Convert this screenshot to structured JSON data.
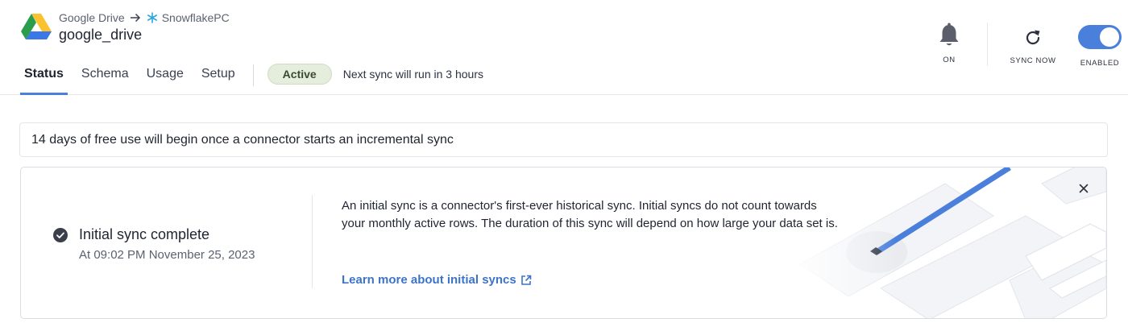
{
  "header": {
    "breadcrumb": {
      "source": "Google Drive",
      "destination": "SnowflakePC"
    },
    "title": "google_drive",
    "tabs": [
      {
        "label": "Status",
        "active": true
      },
      {
        "label": "Schema",
        "active": false
      },
      {
        "label": "Usage",
        "active": false
      },
      {
        "label": "Setup",
        "active": false
      }
    ],
    "status_pill": "Active",
    "next_sync": "Next sync will run in 3 hours",
    "controls": {
      "notifications": {
        "icon": "bell-icon",
        "label": "ON"
      },
      "sync_now": {
        "icon": "refresh-icon",
        "label": "SYNC NOW"
      },
      "enabled": {
        "label": "ENABLED",
        "on": true
      }
    }
  },
  "banner": {
    "text": "14 days of free use will begin once a connector starts an incremental sync"
  },
  "card": {
    "status_title": "Initial sync complete",
    "status_time": "At 09:02 PM November 25, 2023",
    "description": "An initial sync is a connector's first-ever historical sync. Initial syncs do not count towards your monthly active rows. The duration of this sync will depend on how large your data set is.",
    "link": "Learn more about initial syncs",
    "close_icon": "close-icon"
  },
  "colors": {
    "accent": "#4a7fdc",
    "link": "#3d74c9",
    "active_pill_bg": "#e5eedd"
  }
}
